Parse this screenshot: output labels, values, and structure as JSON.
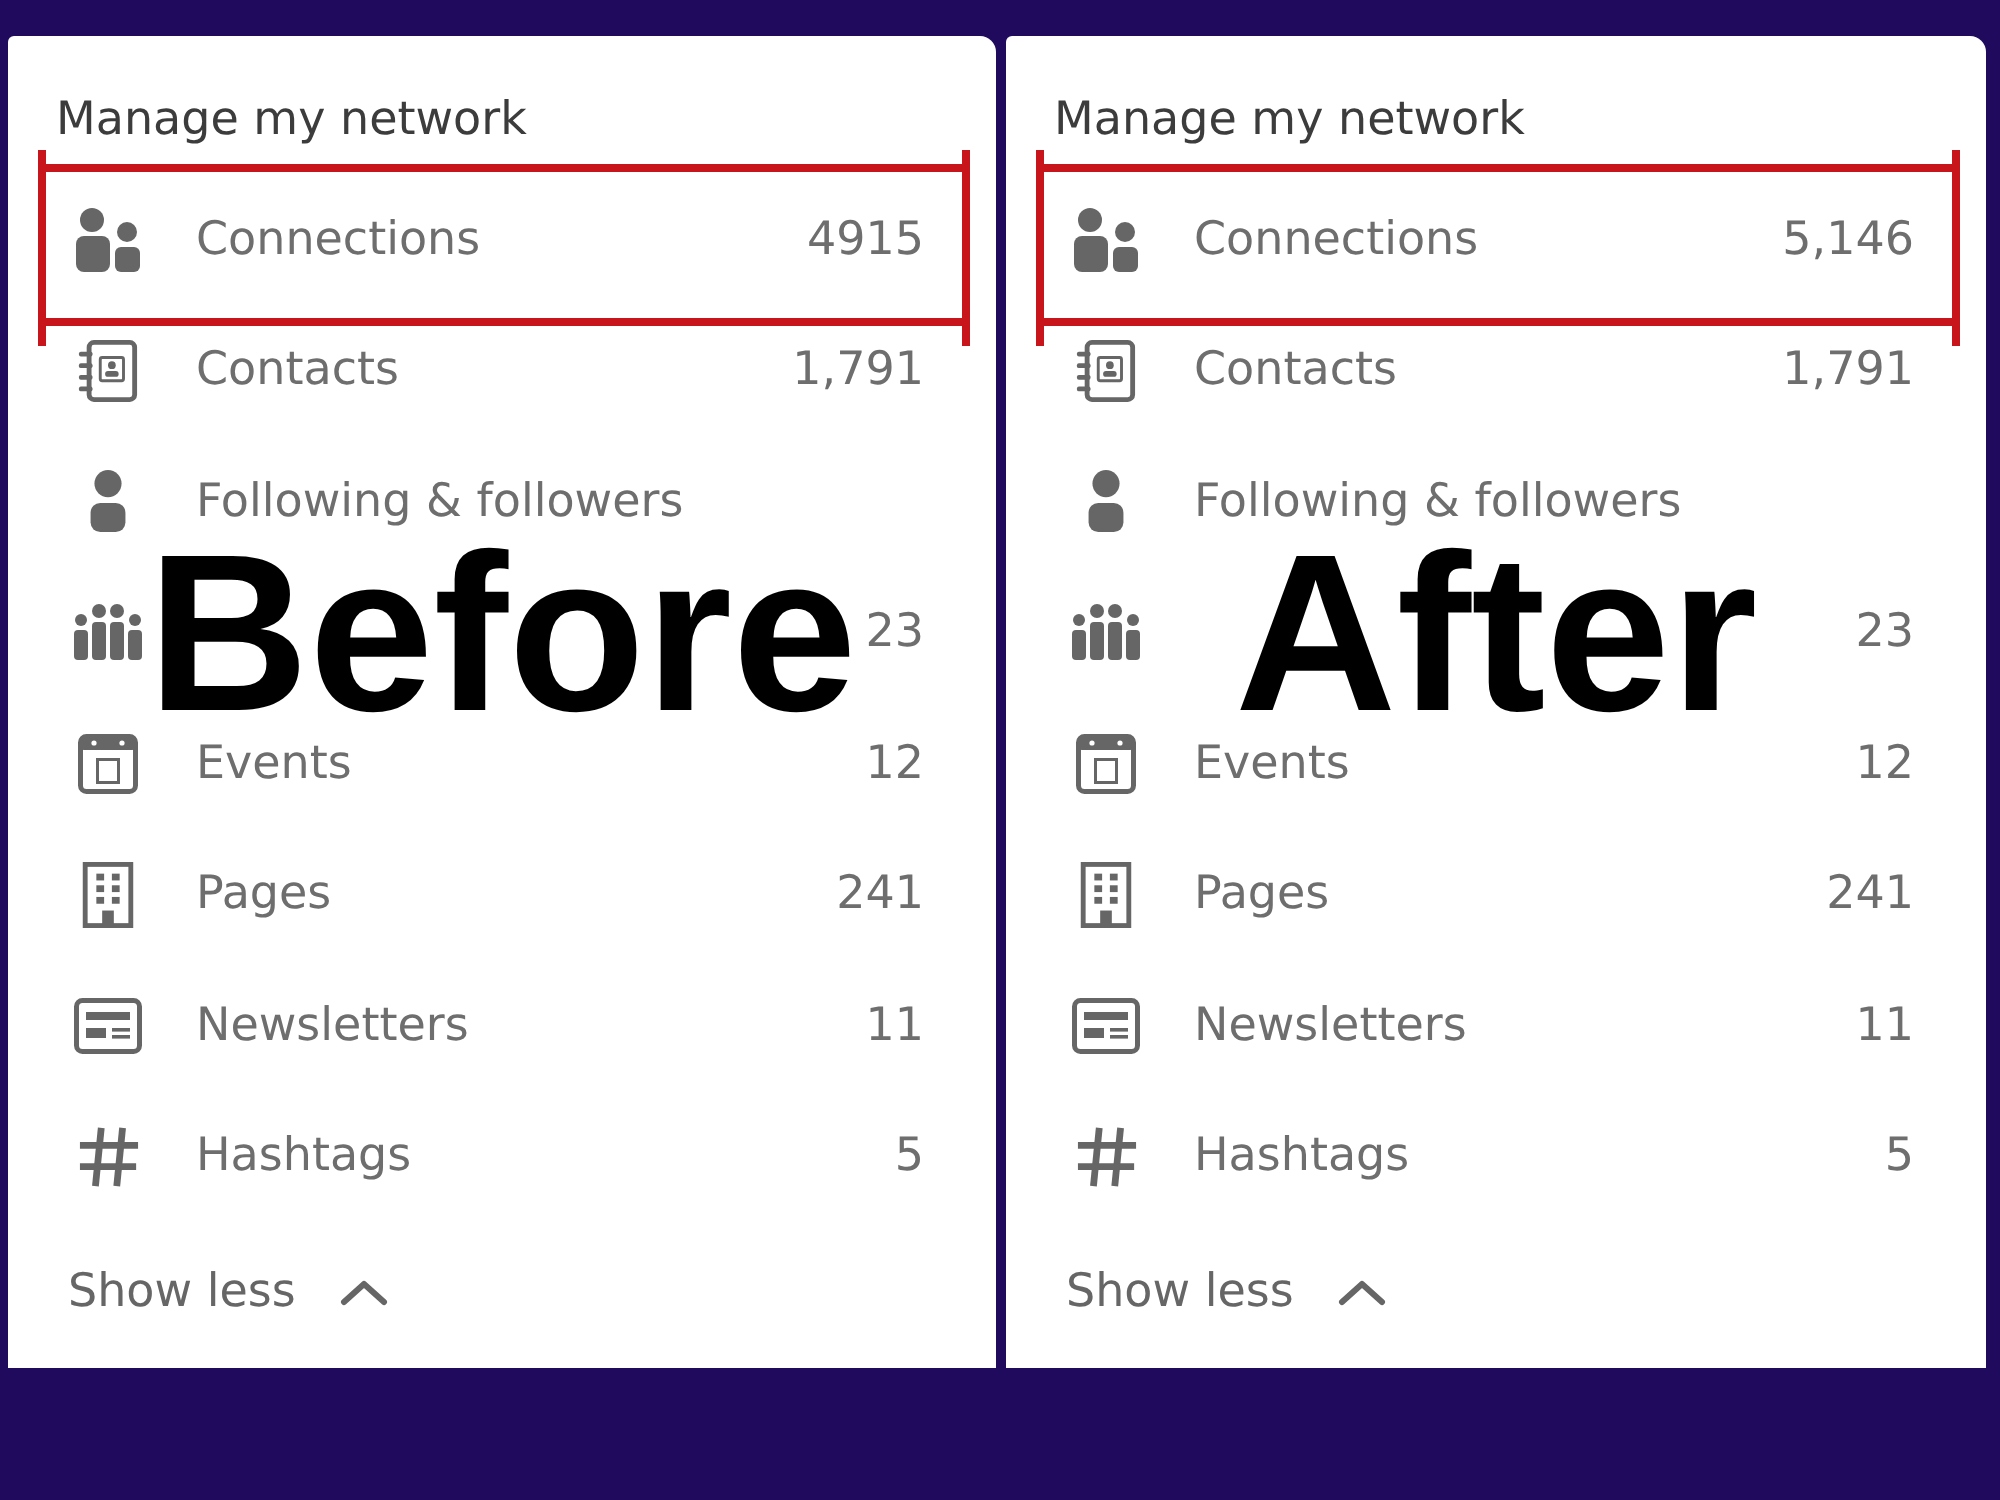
{
  "panels": [
    {
      "caption": "Before",
      "heading": "Manage my network",
      "items": [
        {
          "kind": "connections",
          "label": "Connections",
          "count": "4915",
          "highlighted": true
        },
        {
          "kind": "contacts",
          "label": "Contacts",
          "count": "1,791",
          "highlighted": false
        },
        {
          "kind": "following",
          "label": "Following & followers",
          "highlighted": false
        },
        {
          "kind": "groups",
          "count": "23",
          "highlighted": false
        },
        {
          "kind": "events",
          "label": "Events",
          "count": "12",
          "highlighted": false
        },
        {
          "kind": "pages",
          "label": "Pages",
          "count": "241",
          "highlighted": false
        },
        {
          "kind": "newsletters",
          "label": "Newsletters",
          "count": "11",
          "highlighted": false
        },
        {
          "kind": "hashtags",
          "label": "Hashtags",
          "count": "5",
          "highlighted": false
        }
      ],
      "toggle": "Show less"
    },
    {
      "caption": "After",
      "heading": "Manage my network",
      "items": [
        {
          "kind": "connections",
          "label": "Connections",
          "count": "5,146",
          "highlighted": true
        },
        {
          "kind": "contacts",
          "label": "Contacts",
          "count": "1,791",
          "highlighted": false
        },
        {
          "kind": "following",
          "label": "Following & followers",
          "highlighted": false
        },
        {
          "kind": "groups",
          "count": "23",
          "highlighted": false
        },
        {
          "kind": "events",
          "label": "Events",
          "count": "12",
          "highlighted": false
        },
        {
          "kind": "pages",
          "label": "Pages",
          "count": "241",
          "highlighted": false
        },
        {
          "kind": "newsletters",
          "label": "Newsletters",
          "count": "11",
          "highlighted": false
        },
        {
          "kind": "hashtags",
          "label": "Hashtags",
          "count": "5",
          "highlighted": false
        }
      ],
      "toggle": "Show less"
    }
  ]
}
